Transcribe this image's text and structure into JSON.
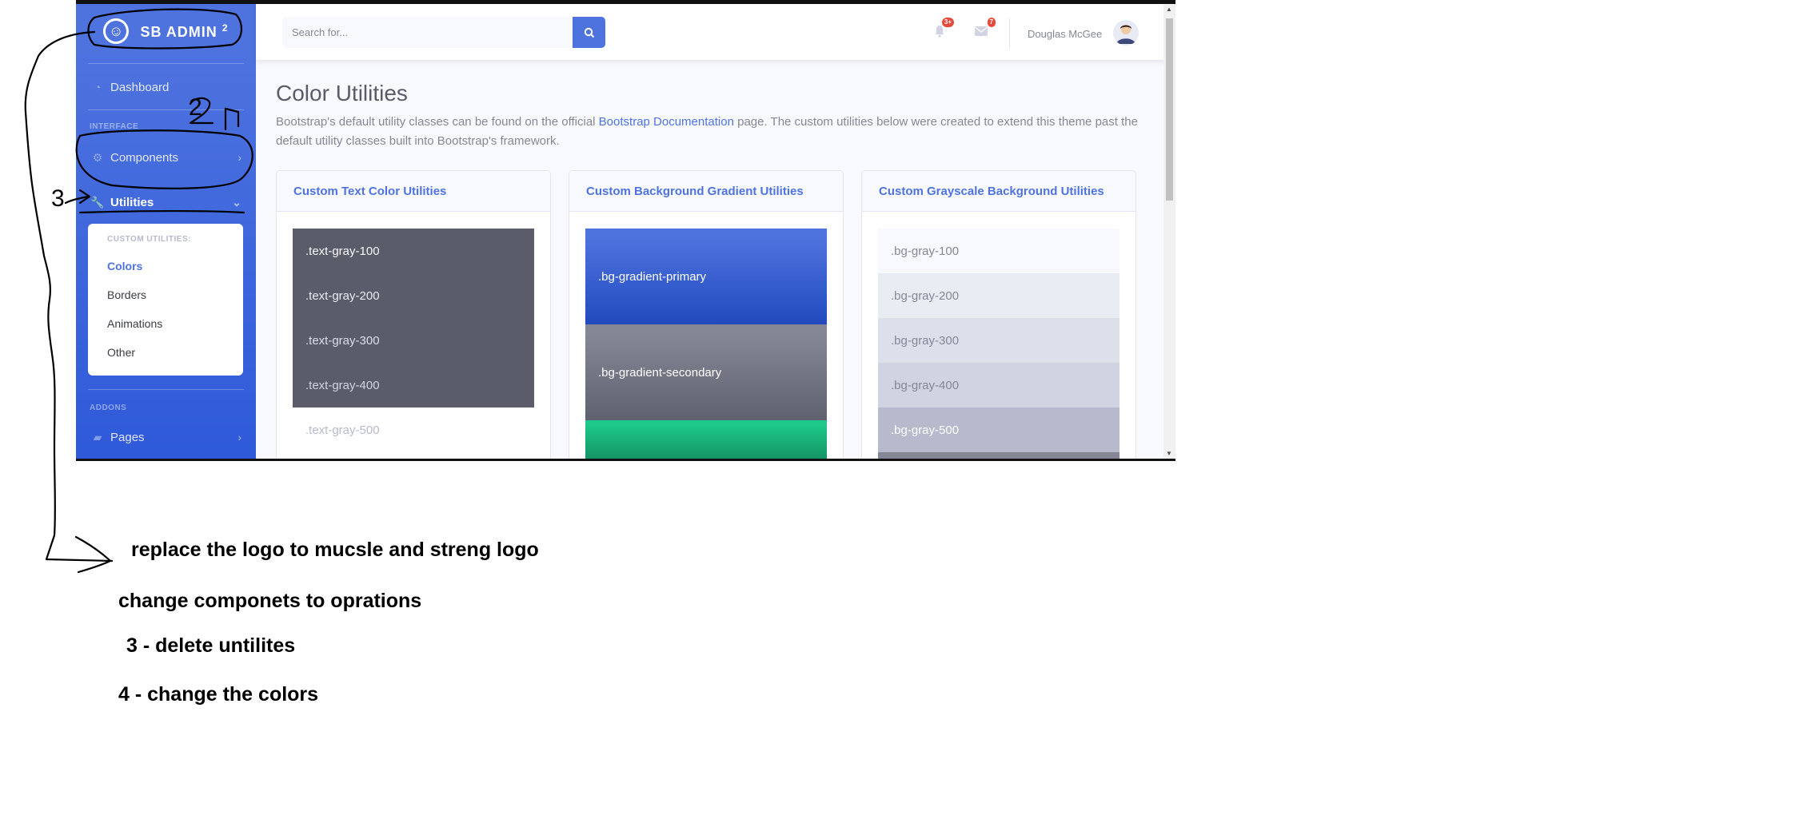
{
  "brand": {
    "name": "SB ADMIN",
    "sup": "2"
  },
  "sidebar": {
    "dashboard": "Dashboard",
    "heading_interface": "INTERFACE",
    "components": "Components",
    "utilities": "Utilities",
    "collapse_header": "CUSTOM UTILITIES:",
    "sub_items": [
      "Colors",
      "Borders",
      "Animations",
      "Other"
    ],
    "heading_addons": "ADDONS",
    "pages": "Pages"
  },
  "topbar": {
    "search_placeholder": "Search for...",
    "alerts_badge": "3+",
    "messages_badge": "7",
    "user_name": "Douglas McGee"
  },
  "page": {
    "title": "Color Utilities",
    "desc_before": "Bootstrap's default utility classes can be found on the official ",
    "desc_link": "Bootstrap Documentation",
    "desc_after": " page. The custom utilities below were created to extend this theme past the default utility classes built into Bootstrap's framework."
  },
  "cards": {
    "text": {
      "title": "Custom Text Color Utilities",
      "items": [
        ".text-gray-100",
        ".text-gray-200",
        ".text-gray-300",
        ".text-gray-400",
        ".text-gray-500"
      ]
    },
    "gradient": {
      "title": "Custom Background Gradient Utilities",
      "items": [
        ".bg-gradient-primary",
        ".bg-gradient-secondary"
      ]
    },
    "gray": {
      "title": "Custom Grayscale Background Utilities",
      "items": [
        ".bg-gray-100",
        ".bg-gray-200",
        ".bg-gray-300",
        ".bg-gray-400",
        ".bg-gray-500"
      ]
    }
  },
  "annotations": {
    "num_2": "2",
    "num_3": "3",
    "note_1": "replace the logo to mucsle and streng logo",
    "note_2": "change componets to oprations",
    "note_3": "3 - delete untilites",
    "note_4": "4 - change the colors"
  },
  "colors": {
    "primary": "#4e73df",
    "sidebar_gradient_end": "#2e59d9",
    "dark_box": "#5a5c69",
    "success": "#1cc88a",
    "danger_badge": "#e74a3b"
  }
}
